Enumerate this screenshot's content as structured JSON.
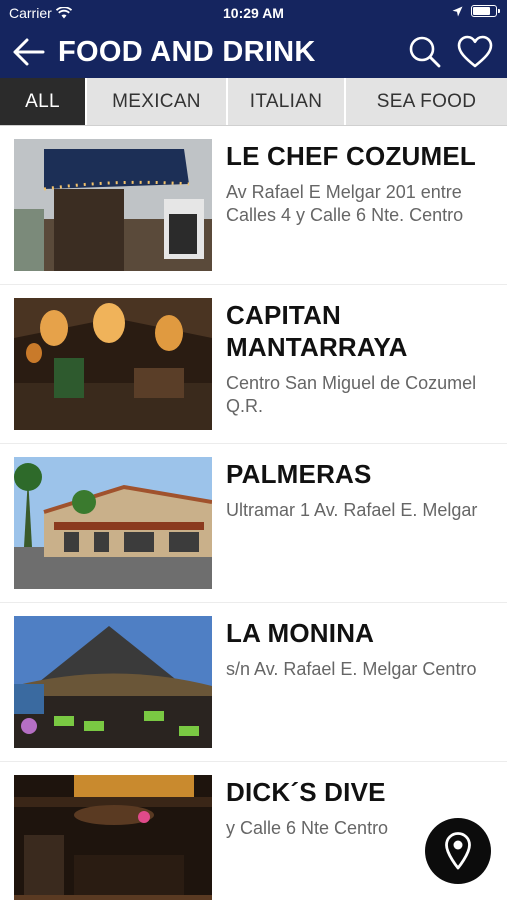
{
  "status_bar": {
    "carrier": "Carrier",
    "time": "10:29 AM",
    "battery_level": 0.8
  },
  "header": {
    "title": "FOOD AND DRINK",
    "color": "#15255f"
  },
  "tabs": [
    {
      "label": "ALL",
      "active": true
    },
    {
      "label": "MEXICAN",
      "active": false
    },
    {
      "label": "ITALIAN",
      "active": false
    },
    {
      "label": "SEA FOOD",
      "active": false
    }
  ],
  "restaurants": [
    {
      "name": "LE CHEF COZUMEL",
      "address": "Av Rafael E Melgar 201 entre Calles 4 y Calle 6 Nte. Centro",
      "image_icon": "restaurant-photo"
    },
    {
      "name": "CAPITAN MANTARRAYA",
      "address": "Centro San Miguel de Cozumel Q.R.",
      "image_icon": "restaurant-photo"
    },
    {
      "name": "PALMERAS",
      "address": "Ultramar 1 Av. Rafael E. Melgar",
      "image_icon": "restaurant-photo"
    },
    {
      "name": "LA MONINA",
      "address": "s/n Av. Rafael E. Melgar Centro",
      "image_icon": "restaurant-photo"
    },
    {
      "name": "DICK´S DIVE",
      "address": "y Calle 6 Nte Centro",
      "image_icon": "restaurant-photo"
    }
  ],
  "map_button": {
    "icon": "map-pin-icon"
  }
}
